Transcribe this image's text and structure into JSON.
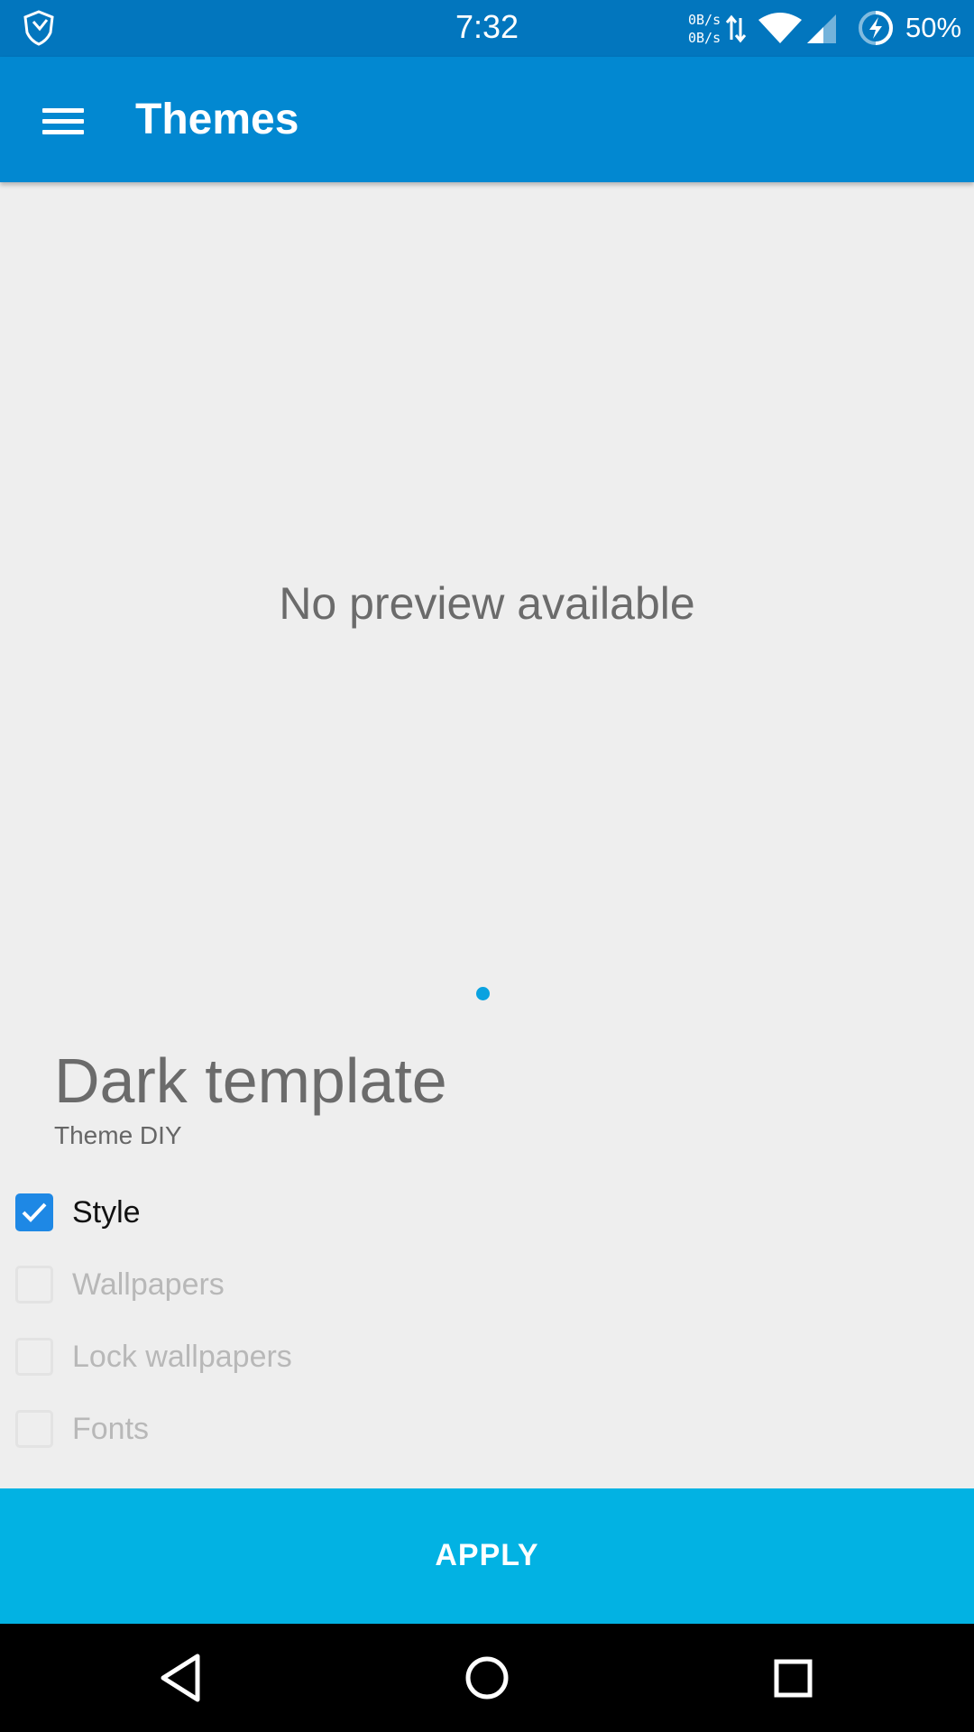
{
  "status_bar": {
    "time": "7:32",
    "net_up": "0B/s",
    "net_down": "0B/s",
    "battery_percent": "50%",
    "icons": [
      "shield-icon",
      "data-arrows-icon",
      "wifi-icon",
      "cell-signal-icon",
      "battery-charging-icon"
    ],
    "color": "#0276be"
  },
  "app_bar": {
    "title": "Themes",
    "menu_icon": "hamburger-menu-icon",
    "color": "#0288d1"
  },
  "preview": {
    "message": "No preview available",
    "page_indicator_color": "#0aa2e0"
  },
  "theme": {
    "name": "Dark template",
    "author": "Theme DIY"
  },
  "options": [
    {
      "label": "Style",
      "checked": true
    },
    {
      "label": "Wallpapers",
      "checked": false
    },
    {
      "label": "Lock wallpapers",
      "checked": false
    },
    {
      "label": "Fonts",
      "checked": false
    }
  ],
  "apply": {
    "label": "APPLY",
    "color": "#02b2e3"
  },
  "nav_bar": {
    "buttons": [
      "back-icon",
      "home-icon",
      "recents-icon"
    ]
  }
}
